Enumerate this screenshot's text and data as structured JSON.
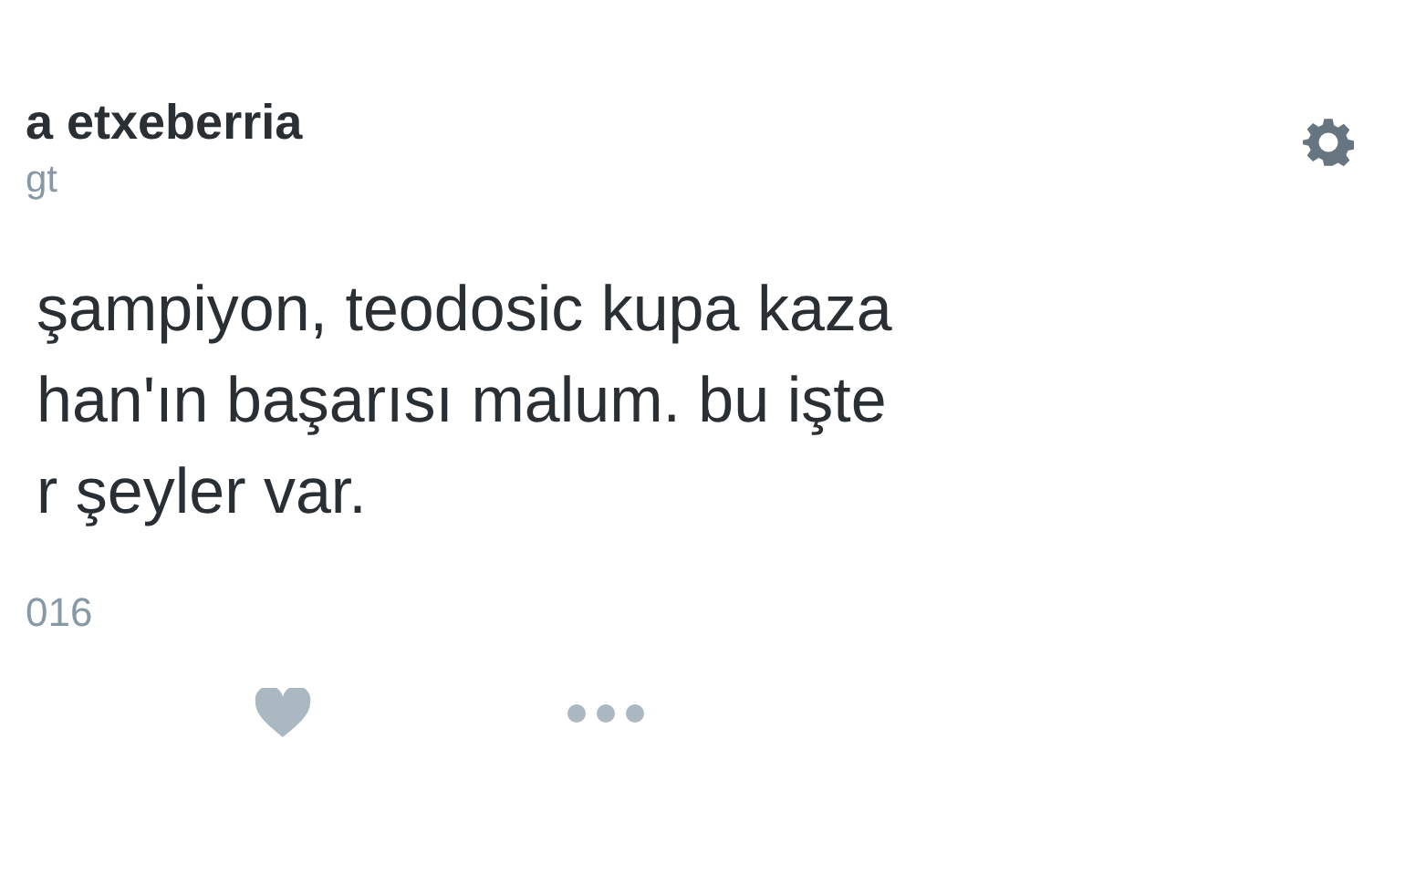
{
  "author": {
    "name": "a etxeberria",
    "handle": "gt"
  },
  "tweet": {
    "lines": [
      "şampiyon, teodosic kupa kaza",
      "han'ın başarısı malum. bu işte",
      "r şeyler var."
    ],
    "date": "016"
  },
  "actions": [
    {
      "kind": "like"
    },
    {
      "kind": "more"
    }
  ]
}
